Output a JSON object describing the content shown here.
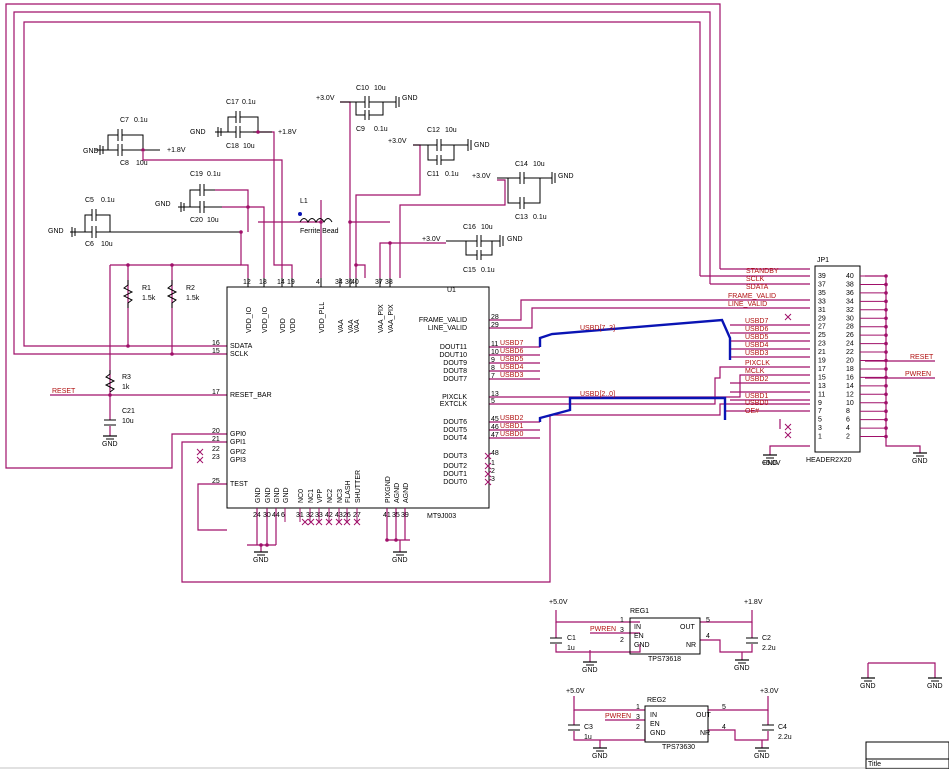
{
  "chip": {
    "name": "U1",
    "part": "MT9J003",
    "top_pins": [
      {
        "num": "12",
        "label": "VDD_IO"
      },
      {
        "num": "18",
        "label": "VDD_IO"
      },
      {
        "num": "14",
        "label": "VDD"
      },
      {
        "num": "19",
        "label": "VDD"
      },
      {
        "num": "4",
        "label": "VDD_PLL"
      },
      {
        "num": "34",
        "label": "VAA"
      },
      {
        "num": "36",
        "label": "VAA"
      },
      {
        "num": "40",
        "label": "VAA"
      },
      {
        "num": "37",
        "label": "VAA_PIX"
      },
      {
        "num": "38",
        "label": "VAA_PIX"
      }
    ],
    "left_pins": [
      {
        "num": "16",
        "label": "SDATA"
      },
      {
        "num": "15",
        "label": "SCLK"
      },
      {
        "num": "17",
        "label": "RESET_BAR"
      },
      {
        "num": "20",
        "label": "GPI0"
      },
      {
        "num": "21",
        "label": "GPI1"
      },
      {
        "num": "22",
        "label": "GPI2"
      },
      {
        "num": "23",
        "label": "GPI3"
      },
      {
        "num": "25",
        "label": "TEST"
      }
    ],
    "right_pins": [
      {
        "num": "28",
        "label": "FRAME_VALID"
      },
      {
        "num": "29",
        "label": "LINE_VALID"
      },
      {
        "num": "11",
        "label": "DOUT11"
      },
      {
        "num": "10",
        "label": "DOUT10"
      },
      {
        "num": "9",
        "label": "DOUT9"
      },
      {
        "num": "8",
        "label": "DOUT8"
      },
      {
        "num": "7",
        "label": "DOUT7"
      },
      {
        "num": "13",
        "label": "PIXCLK"
      },
      {
        "num": "5",
        "label": "EXTCLK"
      },
      {
        "num": "45",
        "label": "DOUT6"
      },
      {
        "num": "46",
        "label": "DOUT5"
      },
      {
        "num": "47",
        "label": "DOUT4"
      },
      {
        "num": "48",
        "label": "DOUT3"
      },
      {
        "num": "1",
        "label": "DOUT2"
      },
      {
        "num": "2",
        "label": "DOUT1"
      },
      {
        "num": "3",
        "label": "DOUT0"
      }
    ],
    "bottom_pins": [
      {
        "num": "24",
        "label": "GND"
      },
      {
        "num": "30",
        "label": "GND"
      },
      {
        "num": "44",
        "label": "GND"
      },
      {
        "num": "6",
        "label": "GND"
      },
      {
        "num": "31",
        "label": "NC0"
      },
      {
        "num": "32",
        "label": "NC1"
      },
      {
        "num": "33",
        "label": "VPP"
      },
      {
        "num": "42",
        "label": "NC2"
      },
      {
        "num": "43",
        "label": "NC3"
      },
      {
        "num": "26",
        "label": "FLASH"
      },
      {
        "num": "27",
        "label": "SHUTTER"
      },
      {
        "num": "41",
        "label": "PIXGND"
      },
      {
        "num": "35",
        "label": "AGND"
      },
      {
        "num": "39",
        "label": "AGND"
      }
    ]
  },
  "bus_labels": {
    "upper_bus": "USBD[7..3]",
    "lower_bus": "USBD[2..0]",
    "upper_nets": [
      "USBD7",
      "USBD6",
      "USBD5",
      "USBD4",
      "USBD3"
    ],
    "lower_nets": [
      "USBD2",
      "USBD1",
      "USBD0"
    ]
  },
  "header": {
    "ref": "JP1",
    "part": "HEADER2X20",
    "left_pin_nums": [
      "39",
      "37",
      "35",
      "33",
      "31",
      "29",
      "27",
      "25",
      "23",
      "21",
      "19",
      "17",
      "15",
      "13",
      "11",
      "9",
      "7",
      "5",
      "3",
      "1"
    ],
    "right_pin_nums": [
      "40",
      "38",
      "36",
      "34",
      "32",
      "30",
      "28",
      "26",
      "24",
      "22",
      "20",
      "18",
      "16",
      "14",
      "12",
      "10",
      "8",
      "6",
      "4",
      "2"
    ],
    "left_nets": [
      "STANDBY",
      "SCLK",
      "SDATA",
      "FRAME_VALID",
      "LINE_VALID"
    ],
    "right_area_nets": [
      "USBD7",
      "USBD6",
      "USBD5",
      "USBD4",
      "USBD3",
      "PIXCLK",
      "MCLK",
      "USBD2",
      "USBD1",
      "USBD0",
      "OE#"
    ],
    "right_nets": [
      "RESET",
      "PWREN"
    ]
  },
  "components": {
    "C7": {
      "ref": "C7",
      "value": "0.1u"
    },
    "C8": {
      "ref": "C8",
      "value": "10u"
    },
    "C17": {
      "ref": "C17",
      "value": "0.1u"
    },
    "C18": {
      "ref": "C18",
      "value": "10u"
    },
    "C10": {
      "ref": "C10",
      "value": "10u"
    },
    "C9": {
      "ref": "C9",
      "value": "0.1u"
    },
    "C12": {
      "ref": "C12",
      "value": "10u"
    },
    "C11": {
      "ref": "C11",
      "value": "0.1u"
    },
    "C14": {
      "ref": "C14",
      "value": "10u"
    },
    "C13": {
      "ref": "C13",
      "value": "0.1u"
    },
    "C19": {
      "ref": "C19",
      "value": "0.1u"
    },
    "C20": {
      "ref": "C20",
      "value": "10u"
    },
    "C5": {
      "ref": "C5",
      "value": "0.1u"
    },
    "C6": {
      "ref": "C6",
      "value": "10u"
    },
    "C16": {
      "ref": "C16",
      "value": "10u"
    },
    "C15": {
      "ref": "C15",
      "value": "0.1u"
    },
    "C21": {
      "ref": "C21",
      "value": "10u"
    },
    "R1": {
      "ref": "R1",
      "value": "1.5k"
    },
    "R2": {
      "ref": "R2",
      "value": "1.5k"
    },
    "R3": {
      "ref": "R3",
      "value": "1k"
    },
    "L1": {
      "ref": "L1",
      "value": "Ferrite Bead"
    }
  },
  "rails": {
    "v18": "+1.8V",
    "v30": "+3.0V",
    "v50": "+5.0V",
    "gnd": "GND",
    "reset": "RESET"
  },
  "regulators": [
    {
      "ref": "REG1",
      "part": "TPS73618",
      "in_label": "IN",
      "en_label": "EN",
      "gnd_label": "GND",
      "out_label": "OUT",
      "nr_label": "NR",
      "pin_in": "1",
      "pin_en": "3",
      "pin_gnd": "2",
      "pin_out": "5",
      "pin_nr": "4",
      "vin": "+5.0V",
      "vout": "+1.8V",
      "enable_net": "PWREN",
      "cin": {
        "ref": "C1",
        "value": "1u"
      },
      "cout": {
        "ref": "C2",
        "value": "2.2u"
      }
    },
    {
      "ref": "REG2",
      "part": "TPS73630",
      "in_label": "IN",
      "en_label": "EN",
      "gnd_label": "GND",
      "out_label": "OUT",
      "nr_label": "NR",
      "pin_in": "1",
      "pin_en": "3",
      "pin_gnd": "2",
      "pin_out": "5",
      "pin_nr": "4",
      "vin": "+5.0V",
      "vout": "+3.0V",
      "enable_net": "PWREN",
      "cin": {
        "ref": "C3",
        "value": "1u"
      },
      "cout": {
        "ref": "C4",
        "value": "2.2u"
      }
    }
  ],
  "title_block": {
    "title_label": "Title"
  },
  "colors": {
    "wire": "#a0106a",
    "net_label": "#b01010",
    "bus": "#0a14b4",
    "text": "#000000"
  }
}
